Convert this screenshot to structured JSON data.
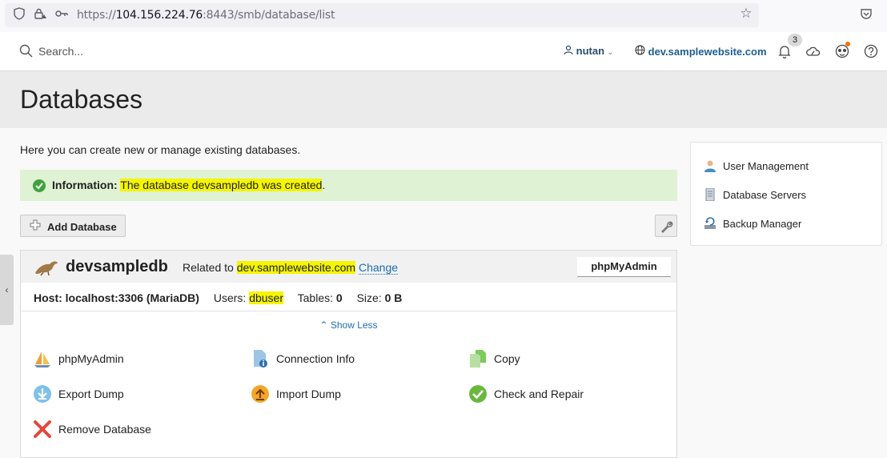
{
  "browser": {
    "url_prefix": "https://",
    "url_host": "104.156.224.76",
    "url_path": ":8443/smb/database/list"
  },
  "header": {
    "search_placeholder": "Search...",
    "user": "nutan",
    "domain": "dev.samplewebsite.com",
    "notifications_count": "3"
  },
  "page": {
    "title": "Databases",
    "intro": "Here you can create new or manage existing databases.",
    "message_label": "Information:",
    "message_text": "The database devsampledb was created",
    "message_end": ".",
    "add_database": "Add Database"
  },
  "database": {
    "name": "devsampledb",
    "related_prefix": "Related to",
    "related_domain": "dev.samplewebsite.com",
    "change": "Change",
    "phpmyadmin_button": "phpMyAdmin",
    "host_label": "Host:",
    "host_value": "localhost:3306 (MariaDB)",
    "users_label": "Users:",
    "users_value": "dbuser",
    "tables_label": "Tables:",
    "tables_value": "0",
    "size_label": "Size:",
    "size_value": "0 B",
    "show_less": "Show Less",
    "actions": [
      {
        "label": "phpMyAdmin",
        "icon": "sailboat-icon"
      },
      {
        "label": "Connection Info",
        "icon": "info-document-icon"
      },
      {
        "label": "Copy",
        "icon": "copy-icon"
      },
      {
        "label": "Export Dump",
        "icon": "download-icon"
      },
      {
        "label": "Import Dump",
        "icon": "upload-icon"
      },
      {
        "label": "Check and Repair",
        "icon": "check-circle-icon"
      },
      {
        "label": "Remove Database",
        "icon": "red-x-icon"
      }
    ]
  },
  "sidebar": {
    "items": [
      {
        "label": "User Management",
        "icon": "user-icon"
      },
      {
        "label": "Database Servers",
        "icon": "server-icon"
      },
      {
        "label": "Backup Manager",
        "icon": "backup-icon"
      }
    ]
  },
  "colors": {
    "success_bg": "#dff2d3",
    "highlight": "#f5f500",
    "link": "#1d6cb0"
  }
}
